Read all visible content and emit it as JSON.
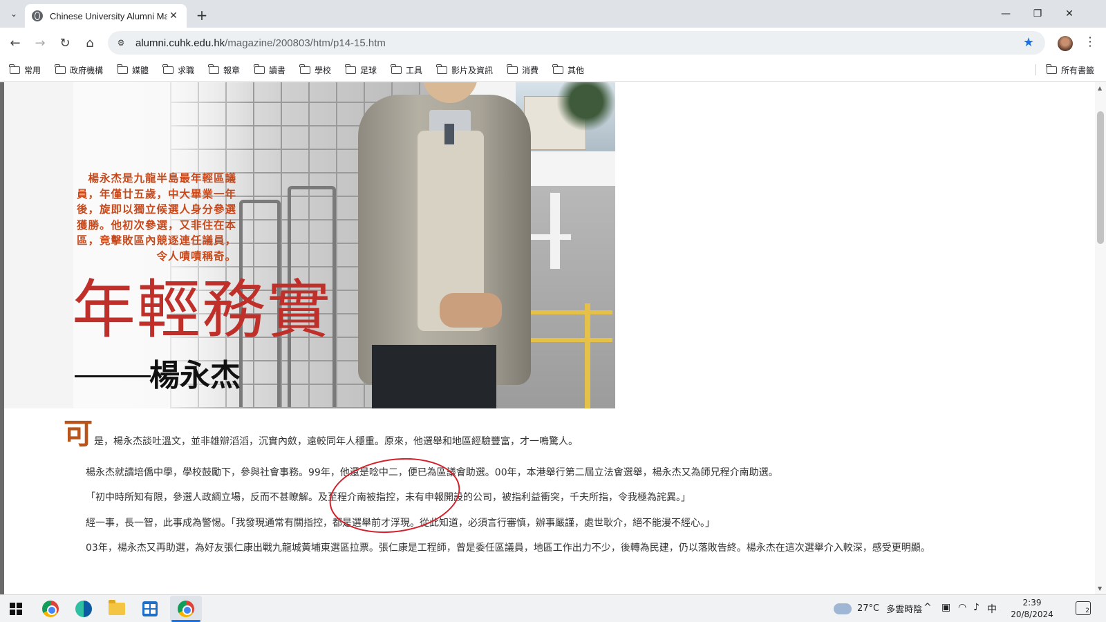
{
  "browser": {
    "tab_title": "Chinese University Alumni Ma",
    "url_host": "alumni.cuhk.edu.hk",
    "url_path": "/magazine/200803/htm/p14-15.htm",
    "bookmarks": [
      "常用",
      "政府機構",
      "媒體",
      "求職",
      "報章",
      "讀書",
      "學校",
      "足球",
      "工具",
      "影片及資訊",
      "消費",
      "其他"
    ],
    "all_bookmarks": "所有書籤"
  },
  "article": {
    "intro": "楊永杰是九龍半島最年輕區議員，年僅廿五歲，中大畢業一年後，旋即以獨立候選人身分參選獲勝。他初次參選，又非住在本區，竟擊敗區內競逐連任議員，令人嘖嘖稱奇。",
    "title": "年輕務實",
    "name": "楊永杰",
    "dropcap": "可",
    "p1": "是，楊永杰談吐溫文，並非雄辯滔滔，沉實內斂，遠較同年人穩重。原來，他選舉和地區經驗豐富，才一鳴驚人。",
    "p2": "楊永杰就讀培僑中學，學校鼓勵下，參與社會事務。99年，他還是唸中二，便已為區議會助選。00年，本港舉行第二屆立法會選舉，楊永杰又為師兄程介南助選。",
    "p3": "「初中時所知有限，參選人政綱立場，反而不甚瞭解。及至程介南被指控，未有申報開設的公司，被指利益衝突，千夫所指，令我極為詫異。」",
    "p4": "經一事，長一智，此事成為警惕。「我發現通常有關指控，都是選舉前才浮現。從此知道，必須言行審慎，辦事嚴謹，處世耿介，絕不能漫不經心。」",
    "p5": "03年，楊永杰又再助選，為好友張仁康出戰九龍城黃埔東選區拉票。張仁康是工程師，曾是委任區議員，地區工作出力不少，後轉為民建，仍以落敗告終。楊永杰在這次選舉介入較深，感受更明顯。"
  },
  "taskbar": {
    "weather_temp": "27°C",
    "weather_desc": "多雲時陰",
    "ime": "中",
    "time": "2:39",
    "date": "20/8/2024",
    "notif_count": "2"
  },
  "colors": {
    "accent_blue": "#1a73e8",
    "title_red": "#c0302a",
    "intro_orange": "#c84a1c",
    "annotation_red": "#d4202a"
  }
}
